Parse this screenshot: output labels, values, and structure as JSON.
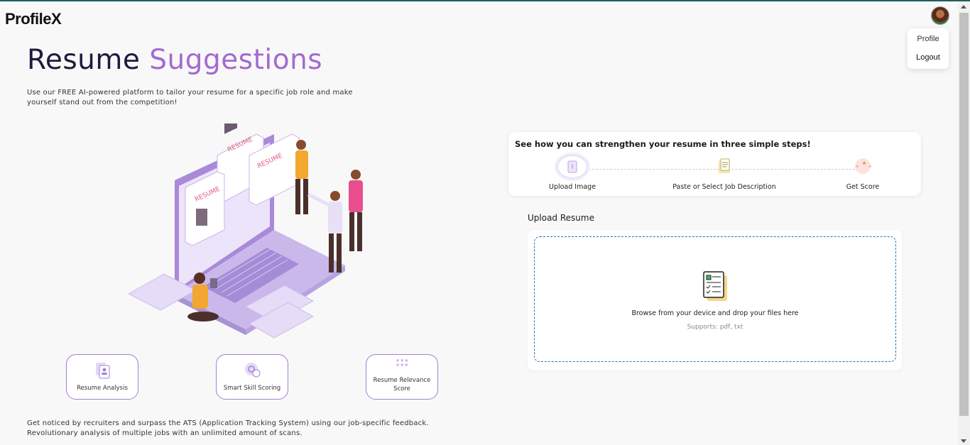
{
  "header": {
    "logo": "ProfileX"
  },
  "user_menu": {
    "profile_label": "Profile",
    "logout_label": "Logout"
  },
  "hero": {
    "title_part1": "Resume",
    "title_part2": "Suggestions",
    "intro": "Use our FREE AI-powered platform to tailor your resume for a specific job role and make yourself stand out from the competition!"
  },
  "illustration": {
    "label": "RESUME"
  },
  "features": [
    {
      "label": "Resume Analysis",
      "icon": "document-person-icon"
    },
    {
      "label": "Smart Skill Scoring",
      "icon": "brain-gear-icon"
    },
    {
      "label": "Resume Relevance Score",
      "icon": "grid-dots-icon"
    }
  ],
  "bottom_text": "Get noticed by recruiters and surpass the ATS (Application Tracking System) using our job-specific feedback. Revolutionary analysis of multiple jobs with an unlimited amount of scans.",
  "steps": {
    "title": "See how you can strengthen your resume in three simple steps!",
    "items": [
      {
        "label": "Upload Image",
        "icon": "upload-document-icon"
      },
      {
        "label": "Paste or Select Job Description",
        "icon": "clipboard-icon"
      },
      {
        "label": "Get Score",
        "icon": "stars-icon"
      }
    ]
  },
  "upload": {
    "title": "Upload Resume",
    "drop_text": "Browse from your device and drop your files here",
    "supports": "Supports: pdf, txt"
  },
  "colors": {
    "title_dark": "#1d1b3e",
    "title_accent": "#a36ad1",
    "feature_border": "#a47fd4",
    "dropzone_border": "#2c6fbf",
    "top_bar": "#1f5f5b"
  }
}
